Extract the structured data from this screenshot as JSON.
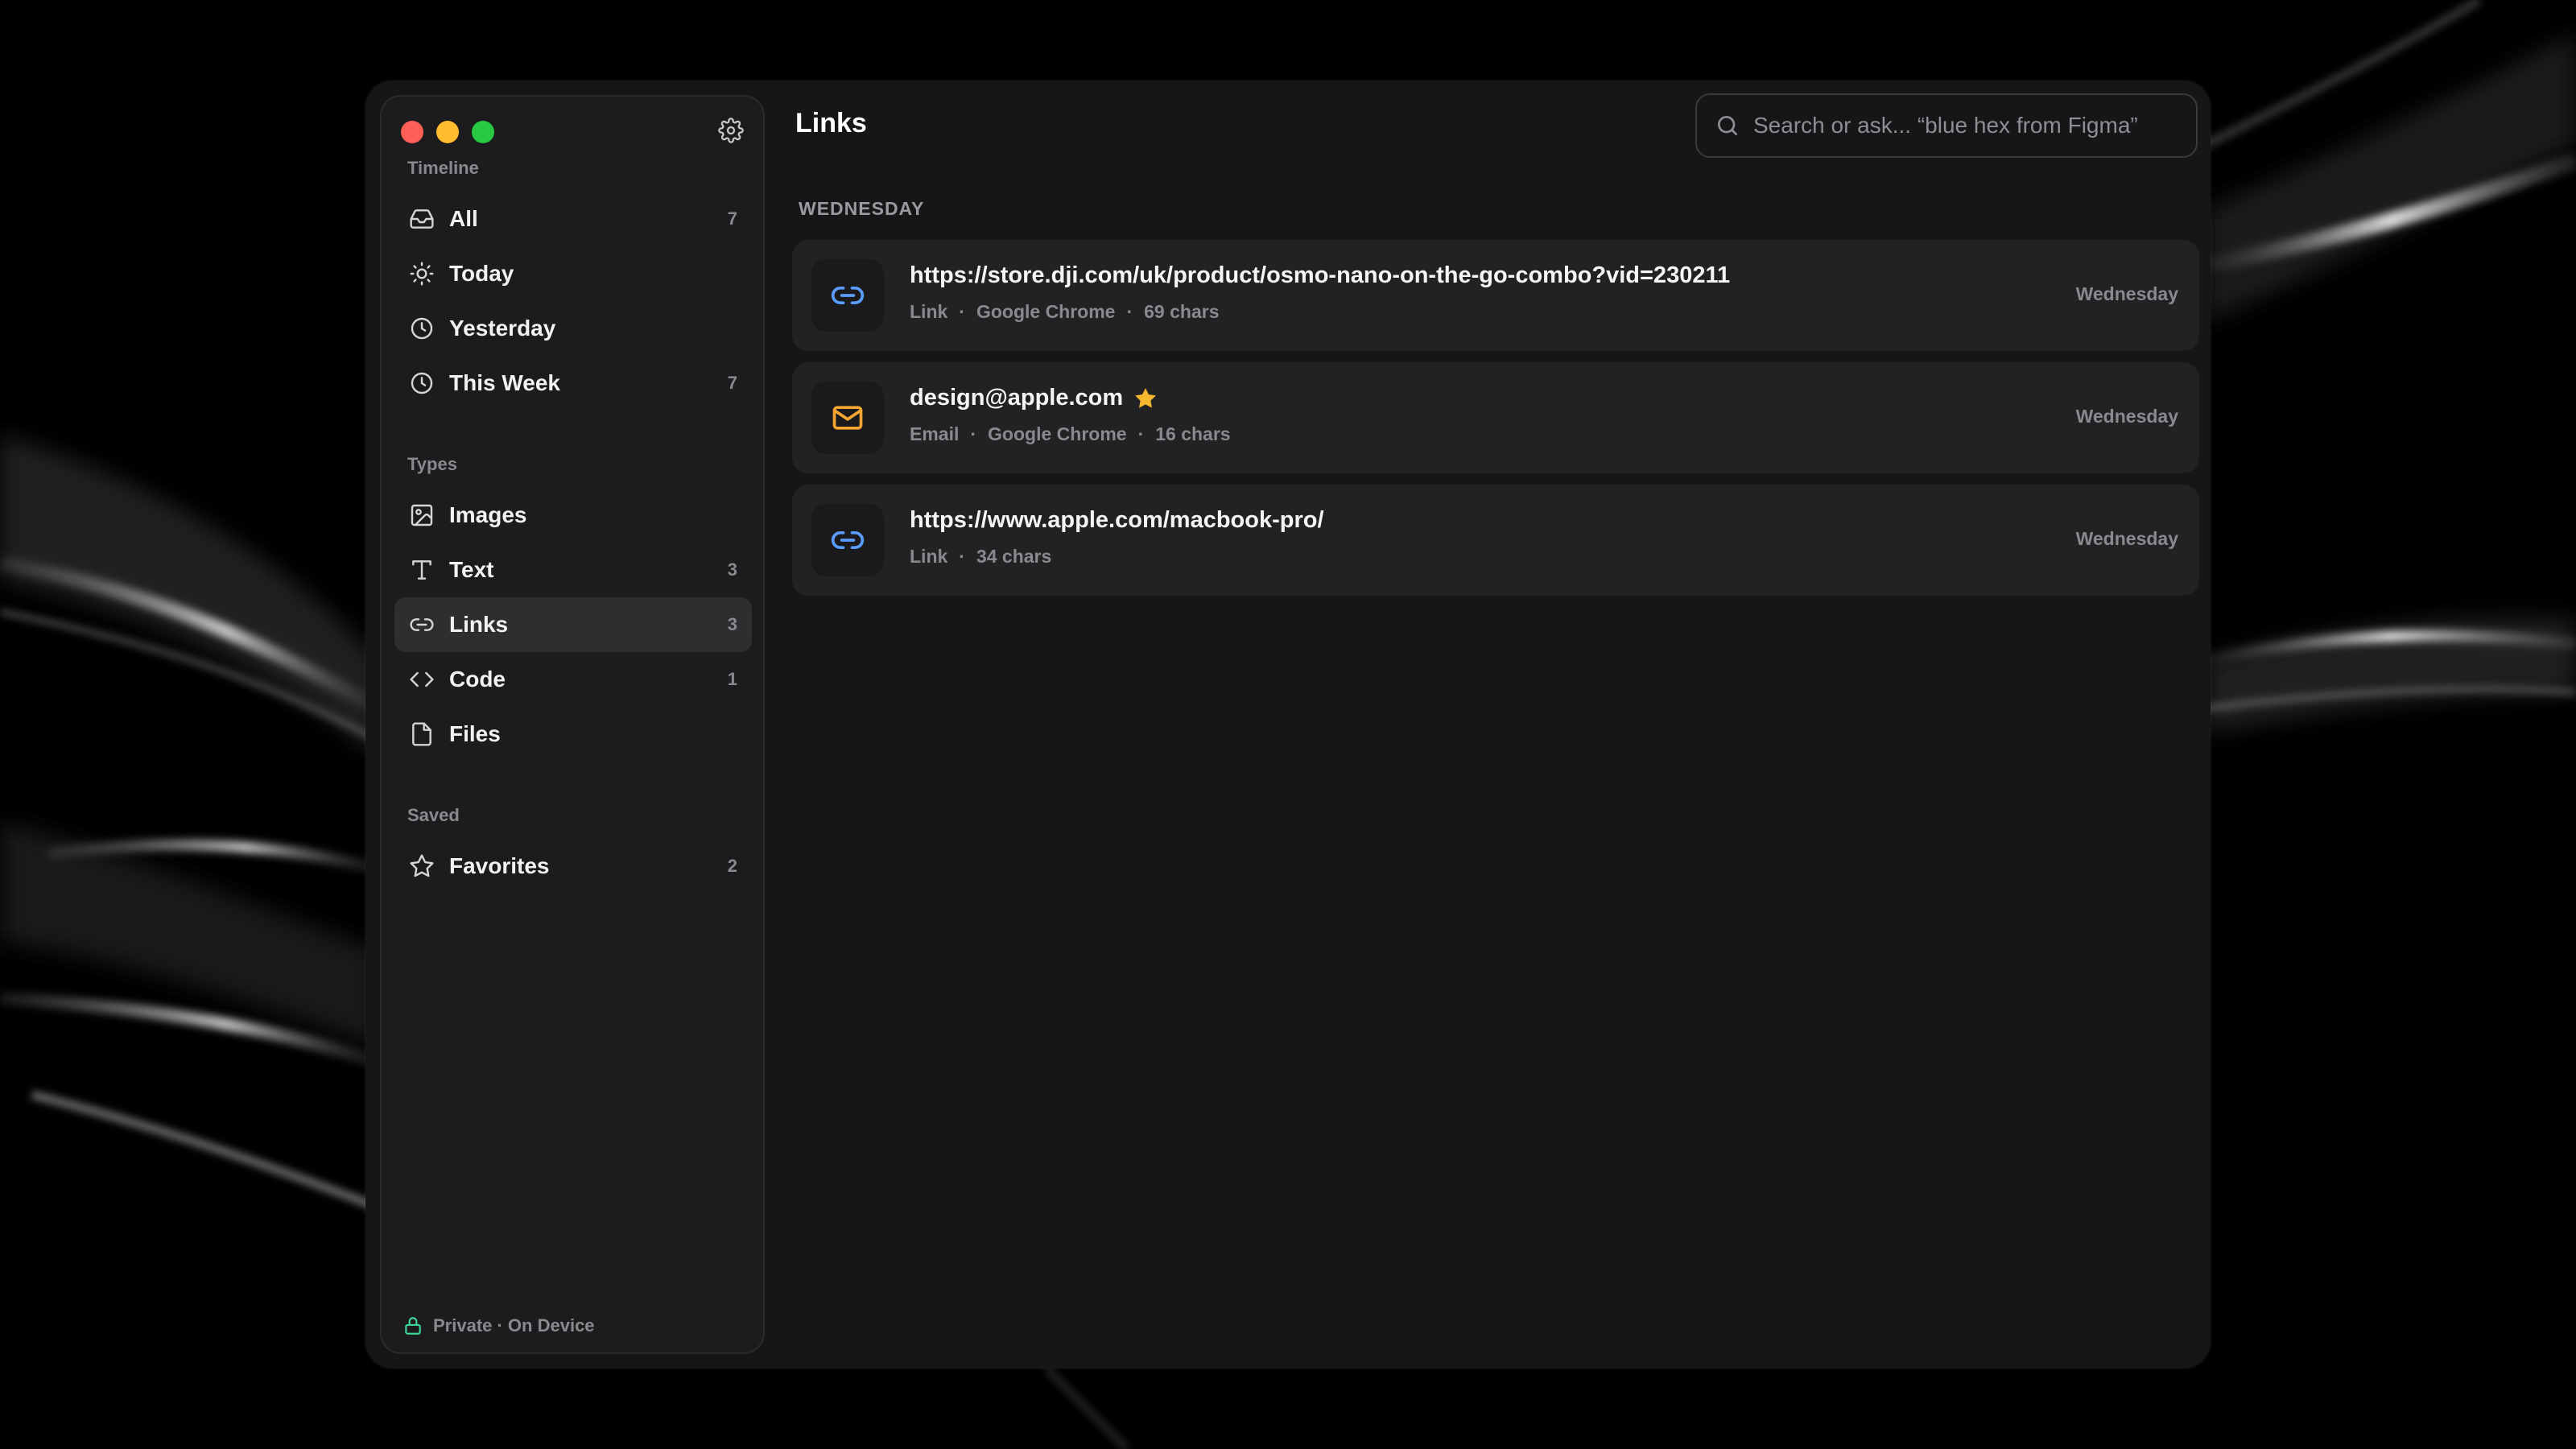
{
  "colors": {
    "close": "#ff5f57",
    "minimize": "#febc2e",
    "zoom": "#28c840",
    "link_accent": "#5b9dff",
    "email_accent": "#f7a531",
    "star": "#f5b82e",
    "lock": "#3dd598"
  },
  "header": {
    "title": "Links",
    "search_placeholder": "Search or ask... “blue hex from Figma”"
  },
  "sidebar": {
    "sections": [
      {
        "label": "Timeline",
        "items": [
          {
            "label": "All",
            "count": "7",
            "icon": "inbox-icon"
          },
          {
            "label": "Today",
            "count": "",
            "icon": "sun-icon"
          },
          {
            "label": "Yesterday",
            "count": "",
            "icon": "clock-icon"
          },
          {
            "label": "This Week",
            "count": "7",
            "icon": "clock-icon"
          }
        ]
      },
      {
        "label": "Types",
        "items": [
          {
            "label": "Images",
            "count": "",
            "icon": "image-icon"
          },
          {
            "label": "Text",
            "count": "3",
            "icon": "text-icon"
          },
          {
            "label": "Links",
            "count": "3",
            "icon": "link-icon",
            "active": true
          },
          {
            "label": "Code",
            "count": "1",
            "icon": "code-icon"
          },
          {
            "label": "Files",
            "count": "",
            "icon": "file-icon"
          }
        ]
      },
      {
        "label": "Saved",
        "items": [
          {
            "label": "Favorites",
            "count": "2",
            "icon": "star-outline-icon"
          }
        ]
      }
    ],
    "footer": "Private · On Device"
  },
  "main": {
    "group_label": "WEDNESDAY",
    "items": [
      {
        "title": "https://store.dji.com/uk/product/osmo-nano-on-the-go-combo?vid=230211",
        "meta": [
          "Link",
          "Google Chrome",
          "69 chars"
        ],
        "date": "Wednesday",
        "icon": "link-icon",
        "favorite": false
      },
      {
        "title": "design@apple.com",
        "meta": [
          "Email",
          "Google Chrome",
          "16 chars"
        ],
        "date": "Wednesday",
        "icon": "mail-icon",
        "favorite": true
      },
      {
        "title": "https://www.apple.com/macbook-pro/",
        "meta": [
          "Link",
          "34 chars"
        ],
        "date": "Wednesday",
        "icon": "link-icon",
        "favorite": false
      }
    ]
  }
}
